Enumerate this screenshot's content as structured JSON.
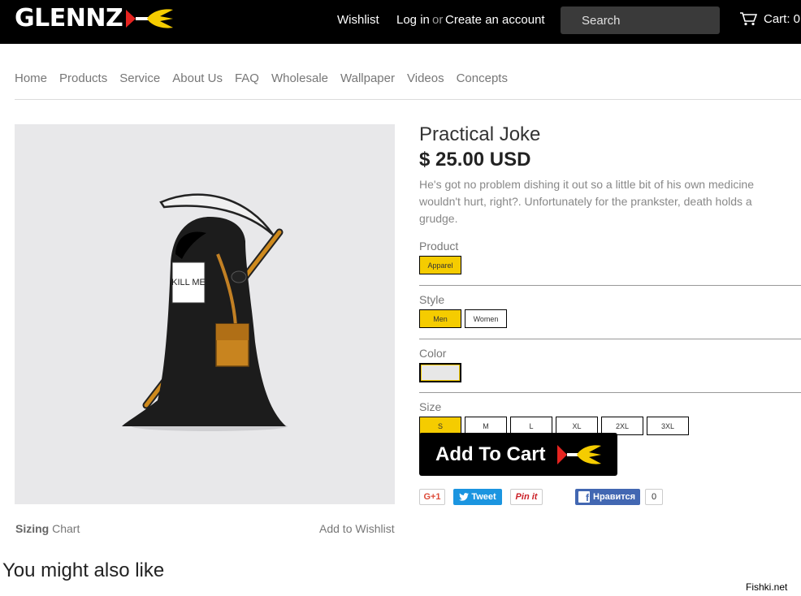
{
  "header": {
    "logo": "GLENNZ",
    "wishlist": "Wishlist",
    "login": "Log in",
    "or": "or",
    "create_account": "Create an account",
    "search_placeholder": "Search",
    "cart": "Cart: 0"
  },
  "nav": [
    "Home",
    "Products",
    "Service",
    "About Us",
    "FAQ",
    "Wholesale",
    "Wallpaper",
    "Videos",
    "Concepts"
  ],
  "product": {
    "title": "Practical Joke",
    "price": "$ 25.00 USD",
    "description": "He's got no problem dishing it out so a little bit of his own medicine wouldn't hurt, right?. Unfortunately for the prankster, death holds a grudge.",
    "sign_text": "KILL ME",
    "options": {
      "product_label": "Product",
      "product_values": [
        "Apparel"
      ],
      "style_label": "Style",
      "style_values": [
        "Men",
        "Women"
      ],
      "color_label": "Color",
      "size_label": "Size",
      "size_values": [
        "S",
        "M",
        "L",
        "XL",
        "2XL",
        "3XL"
      ],
      "selected": {
        "product": "Apparel",
        "style": "Men",
        "size": "S"
      }
    },
    "add_to_cart": "Add To Cart",
    "sizing_bold": "Sizing",
    "sizing_rest": "Chart",
    "add_to_wishlist": "Add to Wishlist"
  },
  "social": {
    "gplus": "G+1",
    "tweet": "Tweet",
    "pin": "Pin it",
    "fb_like": "Нравится",
    "fb_count": "0"
  },
  "also_like": "You might also like",
  "watermark": "Fishki.net",
  "colors": {
    "accent": "#f5cc00",
    "dart_red": "#e52420",
    "header_bg": "#000000"
  }
}
